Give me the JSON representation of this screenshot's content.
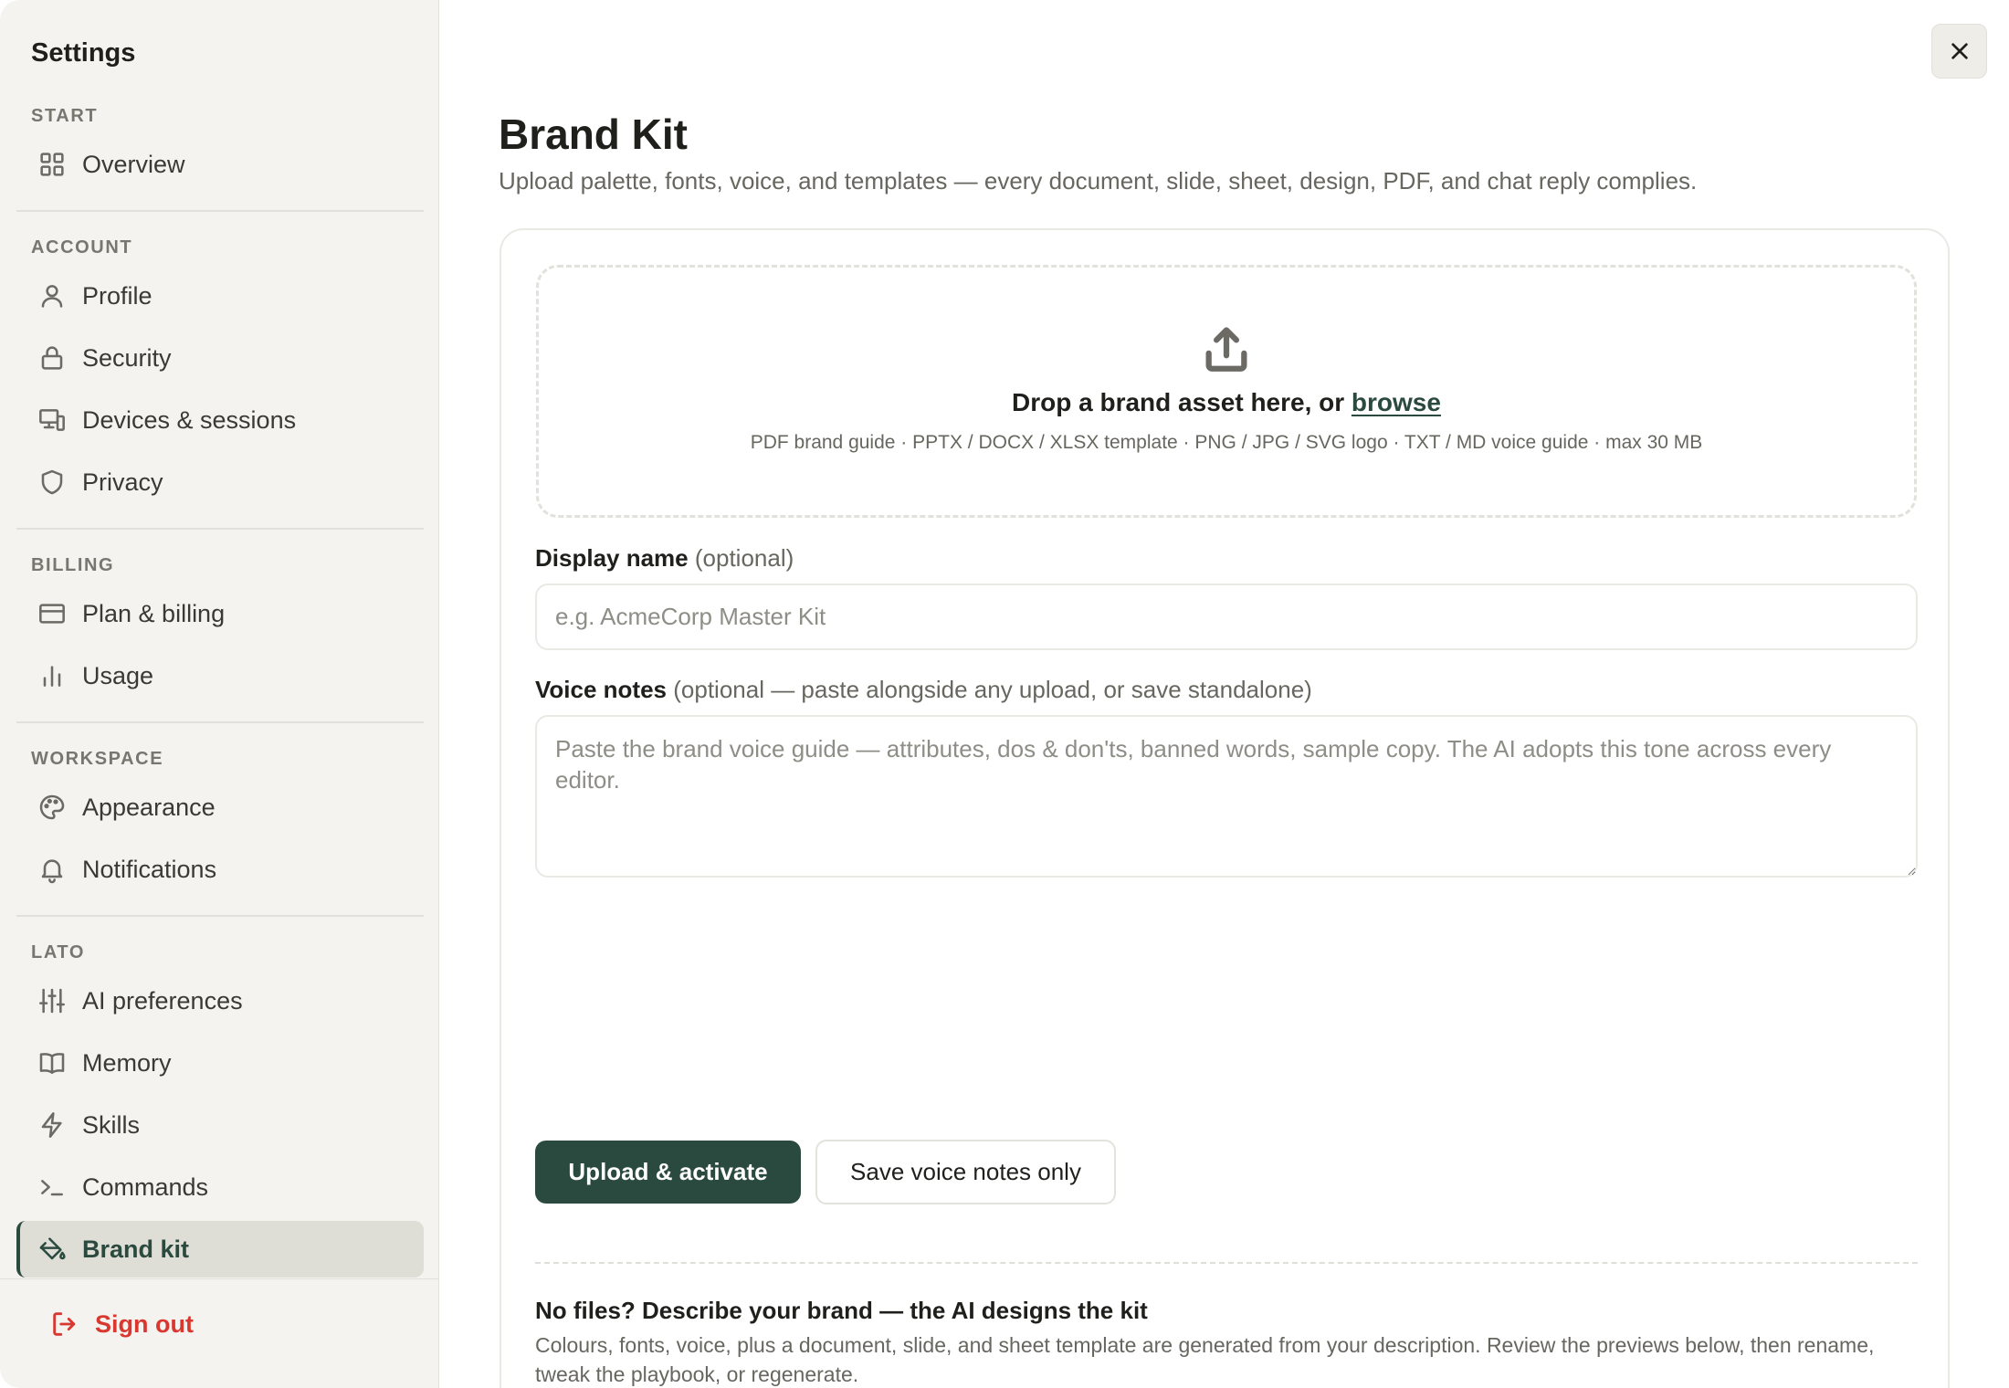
{
  "sidebar": {
    "title": "Settings",
    "sections": [
      {
        "heading": "START",
        "items": [
          {
            "label": "Overview",
            "icon": "grid-icon"
          }
        ]
      },
      {
        "heading": "ACCOUNT",
        "items": [
          {
            "label": "Profile",
            "icon": "user-icon"
          },
          {
            "label": "Security",
            "icon": "lock-icon"
          },
          {
            "label": "Devices & sessions",
            "icon": "devices-icon"
          },
          {
            "label": "Privacy",
            "icon": "shield-icon"
          }
        ]
      },
      {
        "heading": "BILLING",
        "items": [
          {
            "label": "Plan & billing",
            "icon": "credit-card-icon"
          },
          {
            "label": "Usage",
            "icon": "bar-chart-icon"
          }
        ]
      },
      {
        "heading": "WORKSPACE",
        "items": [
          {
            "label": "Appearance",
            "icon": "palette-icon"
          },
          {
            "label": "Notifications",
            "icon": "bell-icon"
          }
        ]
      },
      {
        "heading": "LATO",
        "items": [
          {
            "label": "AI preferences",
            "icon": "sliders-icon"
          },
          {
            "label": "Memory",
            "icon": "book-icon"
          },
          {
            "label": "Skills",
            "icon": "lightning-icon"
          },
          {
            "label": "Commands",
            "icon": "terminal-icon"
          },
          {
            "label": "Brand kit",
            "icon": "paint-bucket-icon",
            "active": true
          }
        ]
      }
    ],
    "sign_out": "Sign out"
  },
  "main": {
    "title": "Brand Kit",
    "subtitle": "Upload palette, fonts, voice, and templates — every document, slide, sheet, design, PDF, and chat reply complies.",
    "dropzone": {
      "text": "Drop a brand asset here, or ",
      "link": "browse",
      "formats": "PDF brand guide · PPTX / DOCX / XLSX template · PNG / JPG / SVG logo · TXT / MD voice guide · max 30 MB"
    },
    "display_name": {
      "label": "Display name",
      "optional": " (optional)",
      "placeholder": "e.g. AcmeCorp Master Kit",
      "value": ""
    },
    "voice_notes": {
      "label": "Voice notes",
      "optional": " (optional — paste alongside any upload, or save standalone)",
      "placeholder": "Paste the brand voice guide — attributes, dos & don'ts, banned words, sample copy. The AI adopts this tone across every editor.",
      "value": ""
    },
    "upload_button": "Upload & activate",
    "save_voice_button": "Save voice notes only",
    "ai_section": {
      "title": "No files? Describe your brand — the AI designs the kit",
      "description": "Colours, fonts, voice, plus a document, slide, and sheet template are generated from your description. Review the previews below, then rename, tweak the playbook, or regenerate."
    }
  },
  "colors": {
    "accent": "#2b4a3f",
    "danger": "#d8382f",
    "sidebar_bg": "#f4f3ef",
    "active_bg": "#deddd6"
  }
}
